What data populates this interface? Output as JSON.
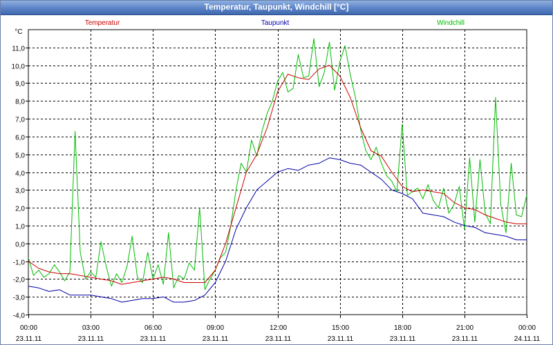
{
  "window": {
    "title": "Temperatur, Taupunkt, Windchill [°C]"
  },
  "colors": {
    "temperatur": "#cc0000",
    "taupunkt": "#0000aa",
    "windchill": "#00bb00",
    "grid": "#000000"
  },
  "chart_data": {
    "type": "line",
    "title": "Temperatur, Taupunkt, Windchill [°C]",
    "ylabel": "°C",
    "ylim": [
      -4.0,
      12.0
    ],
    "xlim": [
      0,
      24
    ],
    "grid": true,
    "legend": "top",
    "yticks": [
      "-4,0",
      "-3,0",
      "-2,0",
      "-1,0",
      "0,0",
      "1,0",
      "2,0",
      "3,0",
      "4,0",
      "5,0",
      "6,0",
      "7,0",
      "8,0",
      "9,0",
      "10,0",
      "11,0"
    ],
    "xticks": [
      {
        "time": "00:00",
        "date": "23.11.11"
      },
      {
        "time": "03:00",
        "date": "23.11.11"
      },
      {
        "time": "06:00",
        "date": "23.11.11"
      },
      {
        "time": "09:00",
        "date": "23.11.11"
      },
      {
        "time": "12:00",
        "date": "23.11.11"
      },
      {
        "time": "15:00",
        "date": "23.11.11"
      },
      {
        "time": "18:00",
        "date": "23.11.11"
      },
      {
        "time": "21:00",
        "date": "23.11.11"
      },
      {
        "time": "00:00",
        "date": "24.11.11"
      }
    ],
    "series": [
      {
        "name": "Temperatur",
        "x": [
          0,
          0.5,
          1,
          1.5,
          2,
          2.5,
          3,
          3.5,
          4,
          4.5,
          5,
          5.5,
          6,
          6.5,
          7,
          7.5,
          8,
          8.5,
          9,
          9.5,
          10,
          10.5,
          11,
          11.5,
          12,
          12.5,
          13,
          13.5,
          14,
          14.5,
          15,
          15.5,
          16,
          16.5,
          17,
          17.5,
          18,
          18.5,
          19,
          19.5,
          20,
          20.5,
          21,
          21.5,
          22,
          22.5,
          23,
          23.5,
          24
        ],
        "values": [
          -1.0,
          -1.4,
          -1.6,
          -1.7,
          -1.7,
          -1.8,
          -1.9,
          -2.0,
          -2.1,
          -2.3,
          -2.2,
          -2.1,
          -2.0,
          -1.9,
          -2.0,
          -2.2,
          -2.2,
          -2.2,
          -1.5,
          0.0,
          2.0,
          4.0,
          5.0,
          6.5,
          8.5,
          9.5,
          9.3,
          9.2,
          9.8,
          10.0,
          9.4,
          8.2,
          6.5,
          5.2,
          4.9,
          4.0,
          3.2,
          2.9,
          3.0,
          2.9,
          2.8,
          2.3,
          2.0,
          1.9,
          1.6,
          1.4,
          1.2,
          1.1,
          1.1
        ]
      },
      {
        "name": "Taupunkt",
        "x": [
          0,
          0.5,
          1,
          1.5,
          2,
          2.5,
          3,
          3.5,
          4,
          4.5,
          5,
          5.5,
          6,
          6.5,
          7,
          7.5,
          8,
          8.5,
          9,
          9.5,
          10,
          10.5,
          11,
          11.5,
          12,
          12.5,
          13,
          13.5,
          14,
          14.5,
          15,
          15.5,
          16,
          16.5,
          17,
          17.5,
          18,
          18.5,
          19,
          19.5,
          20,
          20.5,
          21,
          21.5,
          22,
          22.5,
          23,
          23.5,
          24
        ],
        "values": [
          -2.4,
          -2.5,
          -2.7,
          -2.6,
          -2.9,
          -2.9,
          -2.9,
          -3.0,
          -3.1,
          -3.3,
          -3.2,
          -3.1,
          -3.1,
          -3.0,
          -3.3,
          -3.3,
          -3.2,
          -2.9,
          -2.2,
          -1.0,
          0.8,
          2.0,
          3.0,
          3.5,
          4.0,
          4.2,
          4.1,
          4.4,
          4.5,
          4.8,
          4.7,
          4.5,
          4.4,
          4.0,
          3.6,
          3.0,
          2.8,
          2.5,
          1.7,
          1.6,
          1.5,
          1.2,
          1.0,
          0.9,
          0.6,
          0.5,
          0.4,
          0.2,
          0.2
        ]
      },
      {
        "name": "Windchill",
        "x": [
          0,
          0.25,
          0.5,
          0.75,
          1,
          1.25,
          1.5,
          1.75,
          2,
          2.25,
          2.5,
          2.75,
          3,
          3.25,
          3.5,
          3.75,
          4,
          4.25,
          4.5,
          4.75,
          5,
          5.25,
          5.5,
          5.75,
          6,
          6.25,
          6.5,
          6.75,
          7,
          7.25,
          7.5,
          7.75,
          8,
          8.25,
          8.5,
          8.75,
          9,
          9.25,
          9.5,
          9.75,
          10,
          10.25,
          10.5,
          10.75,
          11,
          11.25,
          11.5,
          11.75,
          12,
          12.25,
          12.5,
          12.75,
          13,
          13.25,
          13.5,
          13.75,
          14,
          14.25,
          14.5,
          14.75,
          15,
          15.25,
          15.5,
          15.75,
          16,
          16.25,
          16.5,
          16.75,
          17,
          17.25,
          17.5,
          17.75,
          18,
          18.25,
          18.5,
          18.75,
          19,
          19.25,
          19.5,
          19.75,
          20,
          20.25,
          20.5,
          20.75,
          21,
          21.25,
          21.5,
          21.75,
          22,
          22.25,
          22.5,
          22.75,
          23,
          23.25,
          23.5,
          23.75,
          24
        ],
        "values": [
          -0.8,
          -1.8,
          -1.5,
          -1.9,
          -1.7,
          -1.2,
          -1.6,
          -2.1,
          -1.6,
          6.3,
          -0.5,
          -2.0,
          -1.6,
          -1.9,
          0.1,
          -1.3,
          -2.4,
          -1.7,
          -2.2,
          -1.3,
          0.4,
          -1.9,
          -2.2,
          -0.5,
          -2.0,
          -1.2,
          -2.3,
          0.6,
          -2.5,
          -1.8,
          -2.0,
          -1.1,
          -1.5,
          2.0,
          -2.6,
          -2.0,
          -1.5,
          -0.8,
          -0.5,
          1.0,
          3.0,
          4.5,
          4.0,
          5.8,
          4.9,
          6.3,
          7.3,
          8.0,
          9.1,
          9.6,
          8.5,
          8.7,
          10.6,
          9.3,
          9.4,
          11.5,
          8.8,
          9.6,
          11.3,
          8.6,
          10.2,
          11.1,
          9.5,
          8.2,
          6.4,
          5.2,
          4.7,
          5.4,
          4.5,
          3.8,
          3.5,
          2.9,
          6.7,
          2.7,
          2.9,
          3.1,
          2.5,
          3.3,
          2.4,
          2.0,
          3.1,
          1.7,
          2.2,
          3.2,
          0.8,
          4.8,
          1.2,
          4.7,
          1.7,
          1.1,
          8.2,
          2.2,
          0.6,
          4.5,
          1.6,
          1.5,
          2.7
        ]
      }
    ]
  }
}
